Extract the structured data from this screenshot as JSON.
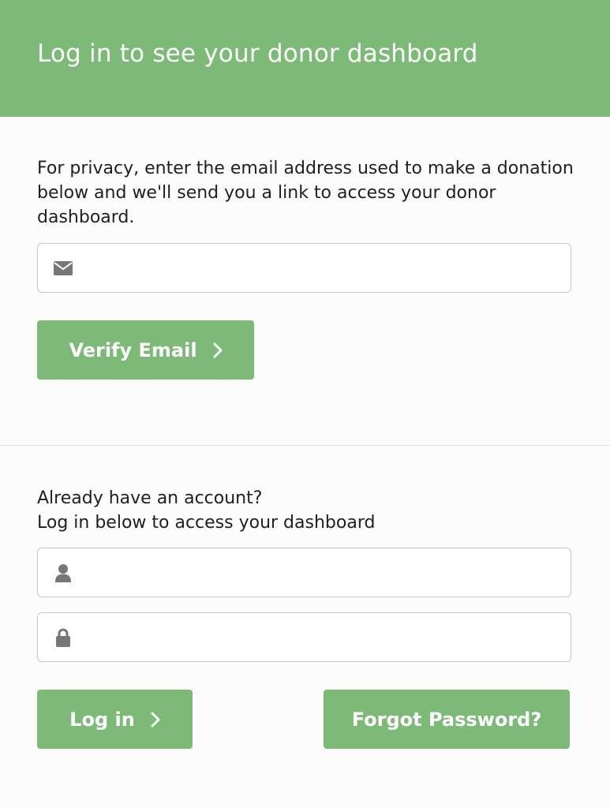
{
  "header": {
    "title": "Log in to see your donor dashboard"
  },
  "verify_section": {
    "intro": "For privacy, enter the email address used to make a donation below and we'll send you a link to access your donor dashboard.",
    "email_field": {
      "value": "",
      "placeholder": "",
      "icon": "envelope-icon"
    },
    "verify_button_label": "Verify Email"
  },
  "login_section": {
    "line1": "Already have an account?",
    "line2": "Log in below to access your dashboard",
    "username_field": {
      "value": "",
      "placeholder": "",
      "icon": "user-icon"
    },
    "password_field": {
      "value": "",
      "placeholder": "",
      "icon": "lock-icon"
    },
    "login_button_label": "Log in",
    "forgot_button_label": "Forgot Password?"
  },
  "colors": {
    "accent": "#7db977",
    "icon": "#777777",
    "border": "#c8c8c8"
  }
}
